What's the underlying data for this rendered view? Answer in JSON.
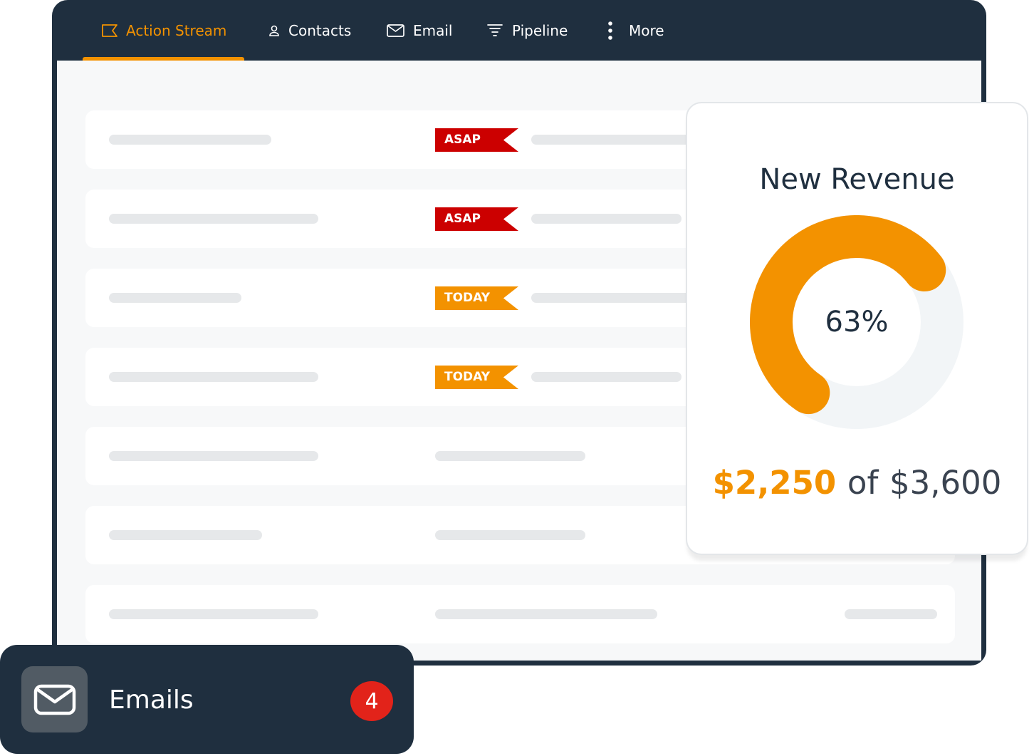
{
  "nav": {
    "tabs": [
      {
        "label": "Action Stream",
        "icon": "action-stream-icon",
        "active": true
      },
      {
        "label": "Contacts",
        "icon": "contact-icon",
        "active": false
      },
      {
        "label": "Email",
        "icon": "email-icon",
        "active": false
      },
      {
        "label": "Pipeline",
        "icon": "pipeline-funnel-icon",
        "active": false
      },
      {
        "label": "More",
        "icon": "more-vertical-icon",
        "active": false
      }
    ]
  },
  "action_stream": {
    "rows": [
      {
        "flag": "ASAP",
        "flag_color": "#cc0000"
      },
      {
        "flag": "ASAP",
        "flag_color": "#cc0000"
      },
      {
        "flag": "TODAY",
        "flag_color": "#f39200"
      },
      {
        "flag": "TODAY",
        "flag_color": "#f39200"
      }
    ]
  },
  "revenue": {
    "title": "New Revenue",
    "percent_label": "63%",
    "progress": 0.63,
    "current": "$2,250",
    "separator": "of",
    "target": "$3,600"
  },
  "email_widget": {
    "label": "Emails",
    "count": "4",
    "icon": "envelope-icon"
  },
  "colors": {
    "navy": "#1f2f3f",
    "accent": "#f39200",
    "asap": "#cc0000",
    "badge": "#e2231a",
    "track": "#f2f5f7"
  }
}
